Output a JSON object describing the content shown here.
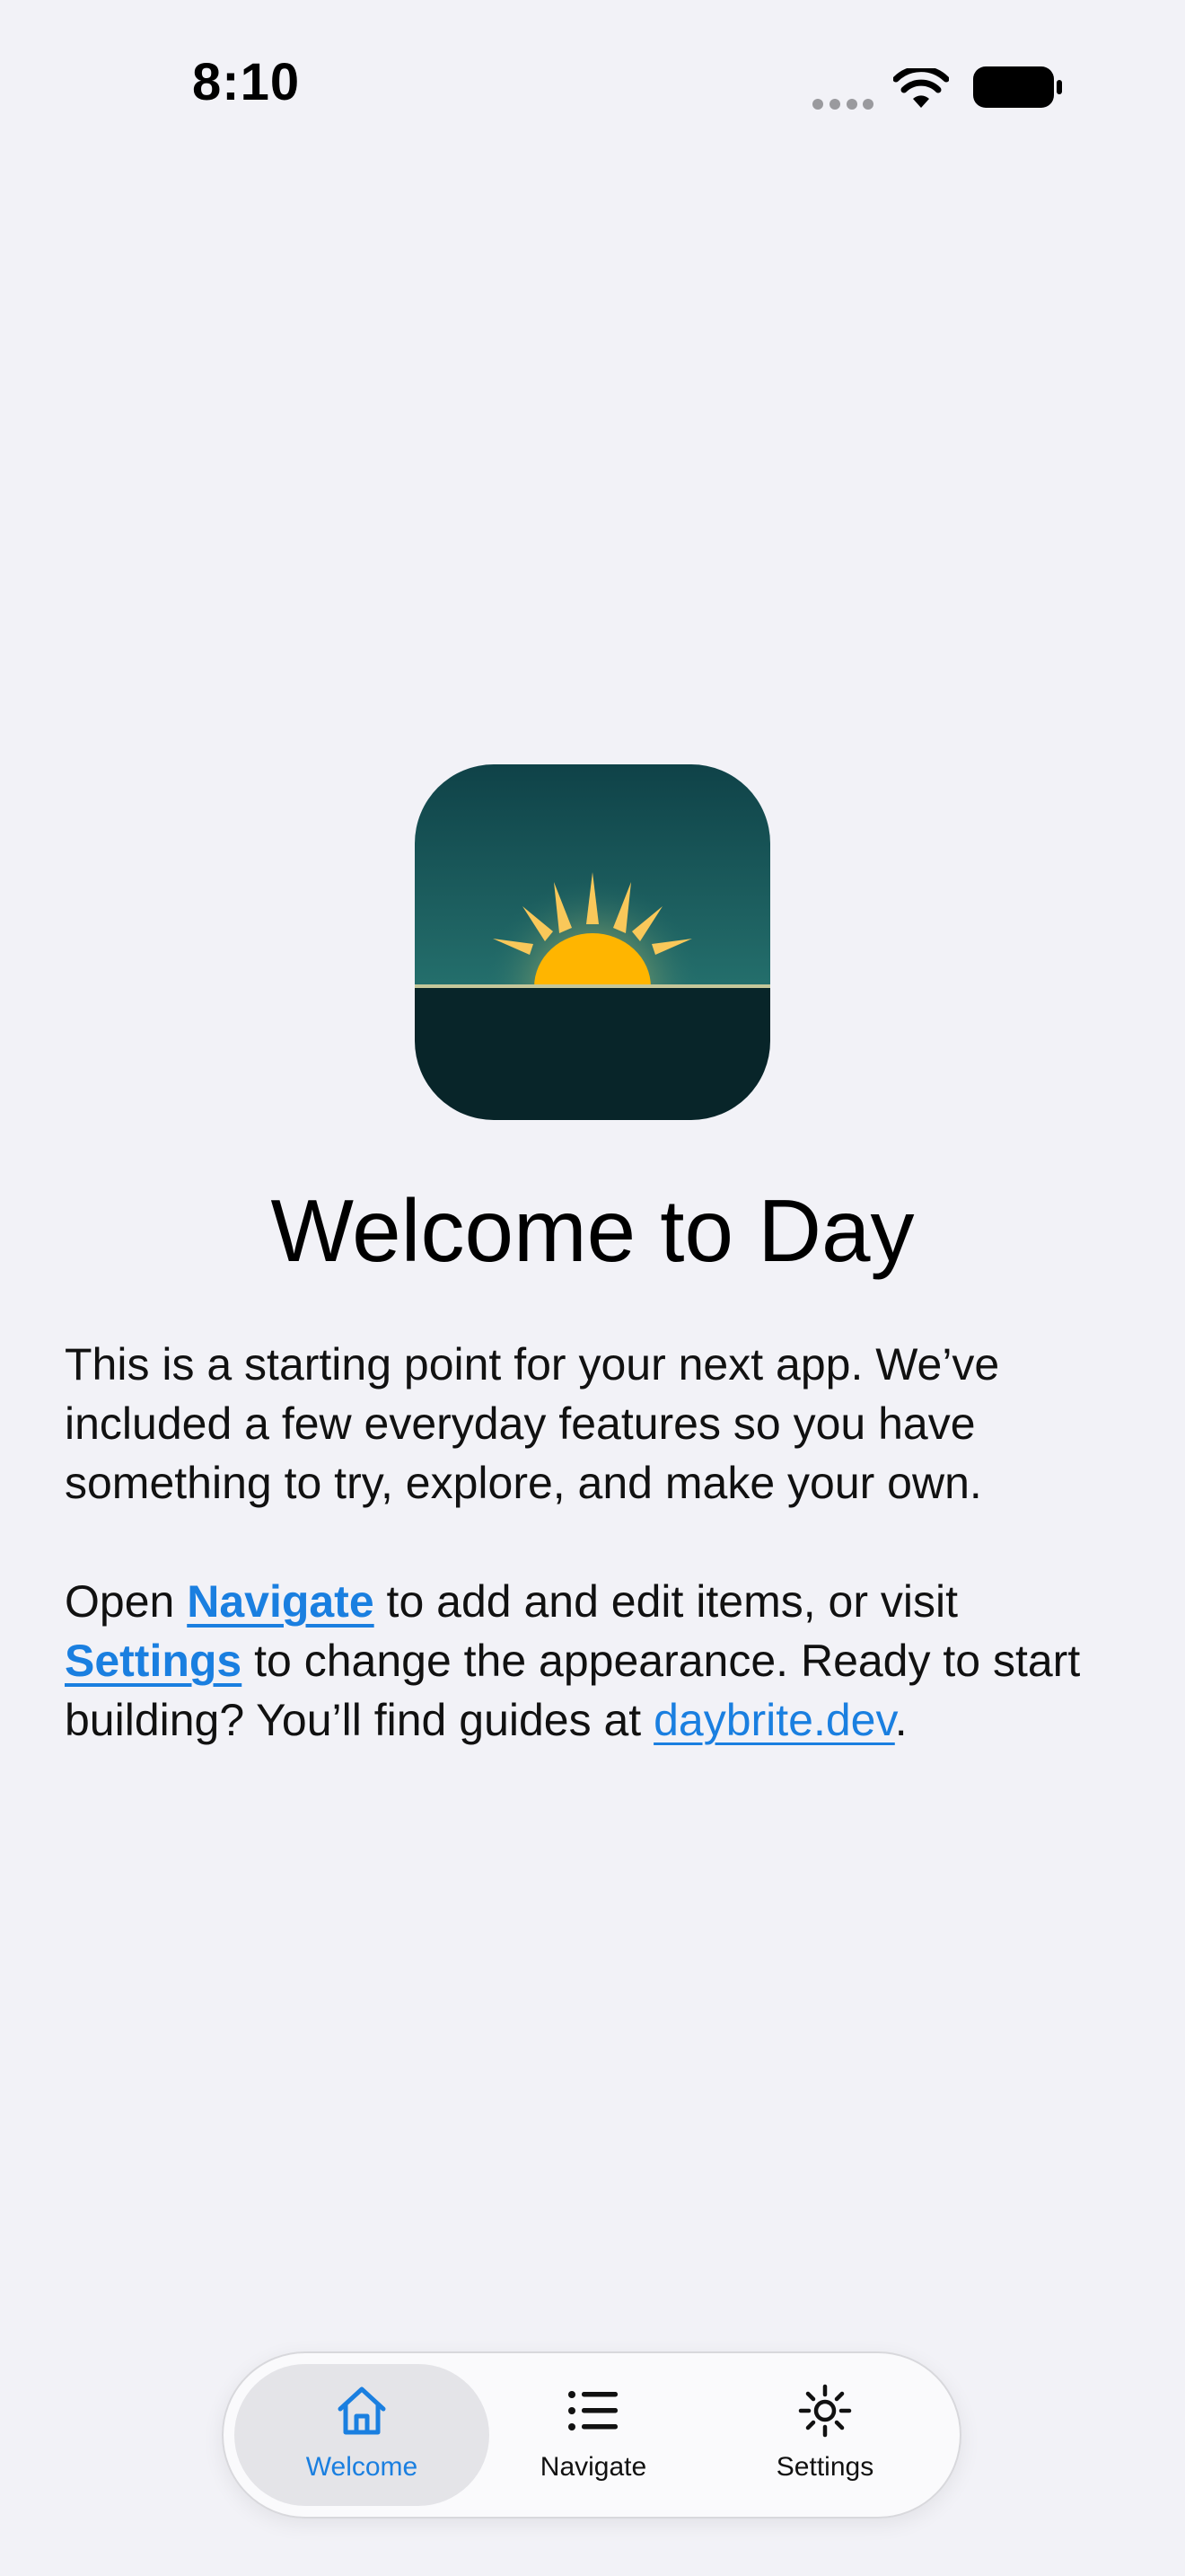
{
  "status_bar": {
    "time": "8:10",
    "icons": [
      "signal-dots-icon",
      "wifi-icon",
      "battery-icon"
    ]
  },
  "app_icon": {
    "name": "sunrise-app-icon",
    "colors": {
      "sky_top": "#0f4248",
      "sky_bottom": "#246f6c",
      "ground": "#082529",
      "sun": "#ffb500",
      "rays": "#f9c85a",
      "horizon": "#c5c79a"
    }
  },
  "welcome": {
    "title": "Welcome to Day",
    "paragraph1": "This is a starting point for your next app. We’ve included a few everyday features so you have something to try, explore, and make your own.",
    "p2_open": "Open ",
    "p2_navigate": "Navigate",
    "p2_middle": " to add and edit items, or visit ",
    "p2_settings": "Settings",
    "p2_rest": " to change the appearance. Ready to start building? You’ll find guides at ",
    "p2_link": "daybrite.dev",
    "p2_end": "."
  },
  "tab_bar": {
    "selected": "Welcome",
    "tabs": [
      {
        "label": "Welcome",
        "icon": "house-icon"
      },
      {
        "label": "Navigate",
        "icon": "list-icon"
      },
      {
        "label": "Settings",
        "icon": "sun-icon"
      }
    ]
  },
  "colors": {
    "background": "#f2f2f7",
    "accent": "#1a7fe0",
    "text": "#000000"
  }
}
